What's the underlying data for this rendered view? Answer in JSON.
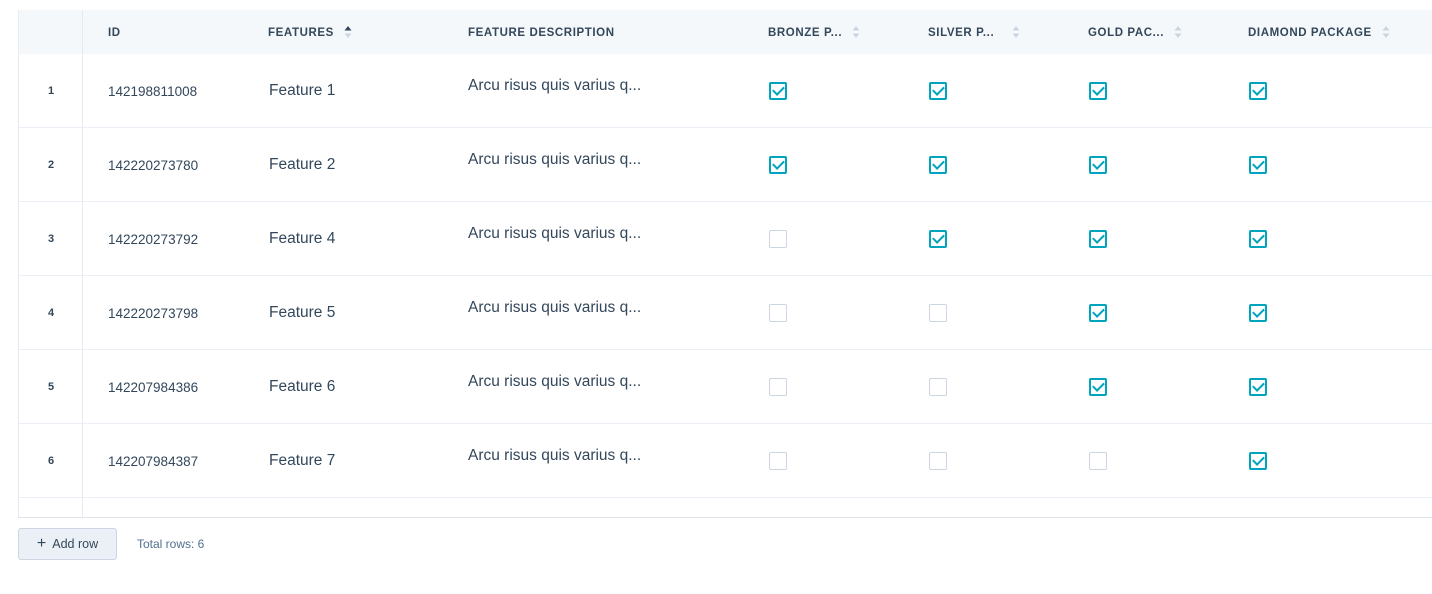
{
  "table": {
    "columns": {
      "id": "ID",
      "features": "FEATURES",
      "description": "FEATURE DESCRIPTION",
      "bronze": "BRONZE P...",
      "silver": "SILVER P...",
      "gold": "GOLD PAC...",
      "diamond": "DIAMOND PACKAGE"
    },
    "rows": [
      {
        "num": "1",
        "id": "142198811008",
        "feature": "Feature 1",
        "description": "Arcu risus quis varius q...",
        "bronze": true,
        "silver": true,
        "gold": true,
        "diamond": true
      },
      {
        "num": "2",
        "id": "142220273780",
        "feature": "Feature 2",
        "description": "Arcu risus quis varius q...",
        "bronze": true,
        "silver": true,
        "gold": true,
        "diamond": true
      },
      {
        "num": "3",
        "id": "142220273792",
        "feature": "Feature 4",
        "description": "Arcu risus quis varius q...",
        "bronze": false,
        "silver": true,
        "gold": true,
        "diamond": true
      },
      {
        "num": "4",
        "id": "142220273798",
        "feature": "Feature 5",
        "description": "Arcu risus quis varius q...",
        "bronze": false,
        "silver": false,
        "gold": true,
        "diamond": true
      },
      {
        "num": "5",
        "id": "142207984386",
        "feature": "Feature 6",
        "description": "Arcu risus quis varius q...",
        "bronze": false,
        "silver": false,
        "gold": true,
        "diamond": true
      },
      {
        "num": "6",
        "id": "142207984387",
        "feature": "Feature 7",
        "description": "Arcu risus quis varius q...",
        "bronze": false,
        "silver": false,
        "gold": false,
        "diamond": true
      }
    ]
  },
  "footer": {
    "add_row_icon": "plus-icon",
    "add_row_label": "Add row",
    "total_rows": "Total rows: 6"
  },
  "colors": {
    "accent": "#00a4bd",
    "header_bg": "#f5f8fa",
    "text": "#33475b"
  }
}
